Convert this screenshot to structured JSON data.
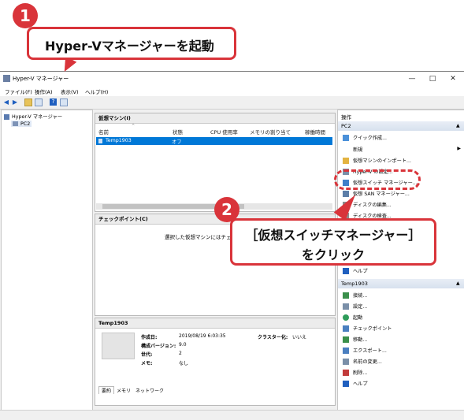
{
  "callout1": {
    "number": "1",
    "text": "Hyper-Vマネージャーを起動"
  },
  "callout2": {
    "number": "2",
    "line1": "［仮想スイッチマネージャー］",
    "line2": "をクリック"
  },
  "window": {
    "title": "Hyper-V マネージャー",
    "controls": {
      "minimize": "—",
      "maximize": "□",
      "close": "✕"
    }
  },
  "menu": [
    "ファイル(F)",
    "操作(A)",
    "表示(V)",
    "ヘルプ(H)"
  ],
  "tree": {
    "root": "Hyper-V マネージャー",
    "child": "PC2"
  },
  "vm_panel": {
    "title": "仮想マシン(I)",
    "columns": [
      "名前",
      "状態",
      "CPU 使用率",
      "メモリの割り当て",
      "稼働時間"
    ],
    "rows": [
      {
        "name": "Temp1903",
        "state": "オフ"
      }
    ]
  },
  "checkpoint_panel": {
    "title": "チェックポイント(C)",
    "message": "選択した仮想マシンにはチェ"
  },
  "details_panel": {
    "title": "Temp1903",
    "fields": [
      {
        "label": "作成日:",
        "value": "2019/08/19 6:03:35"
      },
      {
        "label": "構成バージョン:",
        "value": "9.0"
      },
      {
        "label": "世代:",
        "value": "2"
      },
      {
        "label": "メモ:",
        "value": "なし"
      }
    ],
    "cluster": {
      "label": "クラスター化:",
      "value": "いいえ"
    },
    "tabs": [
      "要約",
      "メモリ",
      "ネットワーク"
    ]
  },
  "actions": {
    "header": "操作",
    "group1": "PC2",
    "group1_items": [
      "クイック作成...",
      "新規",
      "仮想マシンのインポート...",
      "Hyper-V の設定...",
      "仮想スイッチ マネージャー...",
      "仮想 SAN マネージャー...",
      "ディスクの編集...",
      "ディスクの検査...",
      "ヘルプ"
    ],
    "group2": "Temp1903",
    "group2_items": [
      "接続...",
      "設定...",
      "起動",
      "チェックポイント",
      "移動...",
      "エクスポート...",
      "名前の変更...",
      "削除...",
      "ヘルプ"
    ]
  },
  "colors": {
    "accent_red": "#d9343a",
    "selection_blue": "#0078d7"
  }
}
